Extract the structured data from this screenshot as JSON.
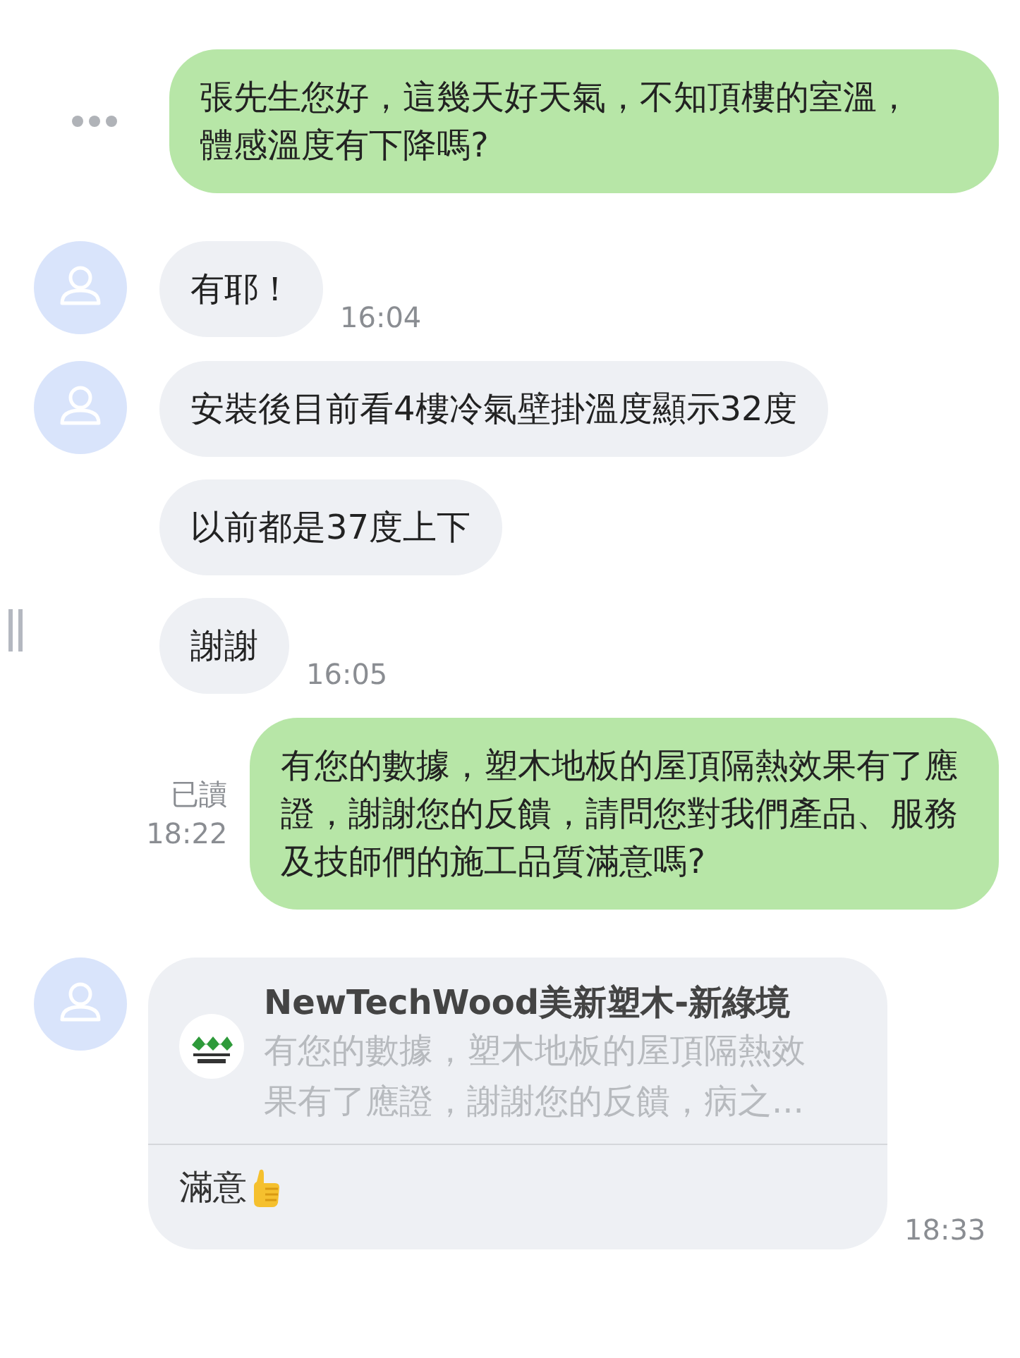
{
  "messages": [
    {
      "kind": "sent",
      "text": "張先生您好，這幾天好天氣，不知頂樓的室溫，體感溫度有下降嗎?",
      "more": true
    },
    {
      "kind": "received",
      "avatar": true,
      "text": "有耶！",
      "time": "16:04"
    },
    {
      "kind": "received",
      "avatar": true,
      "text": "安裝後目前看4樓冷氣壁掛溫度顯示32度"
    },
    {
      "kind": "received",
      "avatar": false,
      "text": "以前都是37度上下"
    },
    {
      "kind": "received",
      "avatar": false,
      "handle": true,
      "text": "謝謝",
      "time": "16:05"
    },
    {
      "kind": "sent",
      "text": "有您的數據，塑木地板的屋頂隔熱效果有了應證，謝謝您的反饋，請問您對我們產品、服務及技師們的施工品質滿意嗎?",
      "read": "已讀",
      "time": "18:22"
    },
    {
      "kind": "reply",
      "avatar": true,
      "quote_name": "NewTechWood美新塑木-新綠境",
      "quote_text": "有您的數據，塑木地板的屋頂隔熱效果有了應證，謝謝您的反饋，病之...",
      "text": "滿意",
      "thumbs_up": true,
      "time": "18:33"
    }
  ]
}
